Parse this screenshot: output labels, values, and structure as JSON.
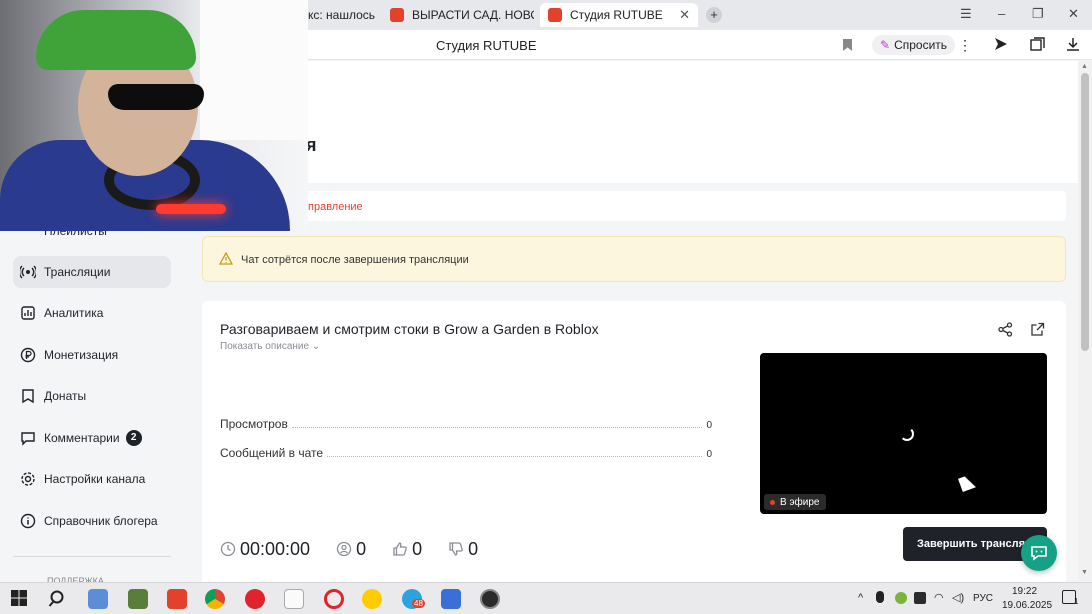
{
  "browser": {
    "tabs": [
      {
        "label": "кс: нашлось"
      },
      {
        "label": "ВЫРАСТИ САД. НОВОЕ С"
      },
      {
        "label": "Студия RUTUBE"
      }
    ],
    "page_title": "Студия RUTUBE",
    "ask_button": "Спросить"
  },
  "header": {
    "title_fragment": "я",
    "subtab_active": "правление"
  },
  "sidebar": {
    "items": [
      {
        "label": "Плейлисты"
      },
      {
        "label": "Трансляции"
      },
      {
        "label": "Аналитика"
      },
      {
        "label": "Монетизация"
      },
      {
        "label": "Донаты"
      },
      {
        "label": "Комментарии",
        "badge": "2"
      },
      {
        "label": "Настройки канала"
      },
      {
        "label": "Справочник блогера"
      }
    ],
    "section_label": "ПОДДЕРЖКА"
  },
  "alert": {
    "text": "Чат сотрётся после завершения трансляции"
  },
  "stream": {
    "title": "Разговариваем и смотрим стоки в Grow a Garden в Roblox",
    "show_description": "Показать описание",
    "stats": [
      {
        "label": "Просмотров",
        "value": "0"
      },
      {
        "label": "Сообщений в чате",
        "value": "0"
      }
    ],
    "live_badge": "В эфире",
    "timer": "00:00:00",
    "viewers": "0",
    "likes": "0",
    "dislikes": "0",
    "end_button": "Завершить трансляцию"
  },
  "taskbar": {
    "badge_count": "48",
    "language": "РУС",
    "time": "19:22",
    "date": "19.06.2025",
    "notification_count": "1"
  },
  "colors": {
    "accent": "#e2422c",
    "alert_bg": "#fdf6df",
    "dark_button": "#1f2229",
    "chat_fab": "#16a085"
  }
}
